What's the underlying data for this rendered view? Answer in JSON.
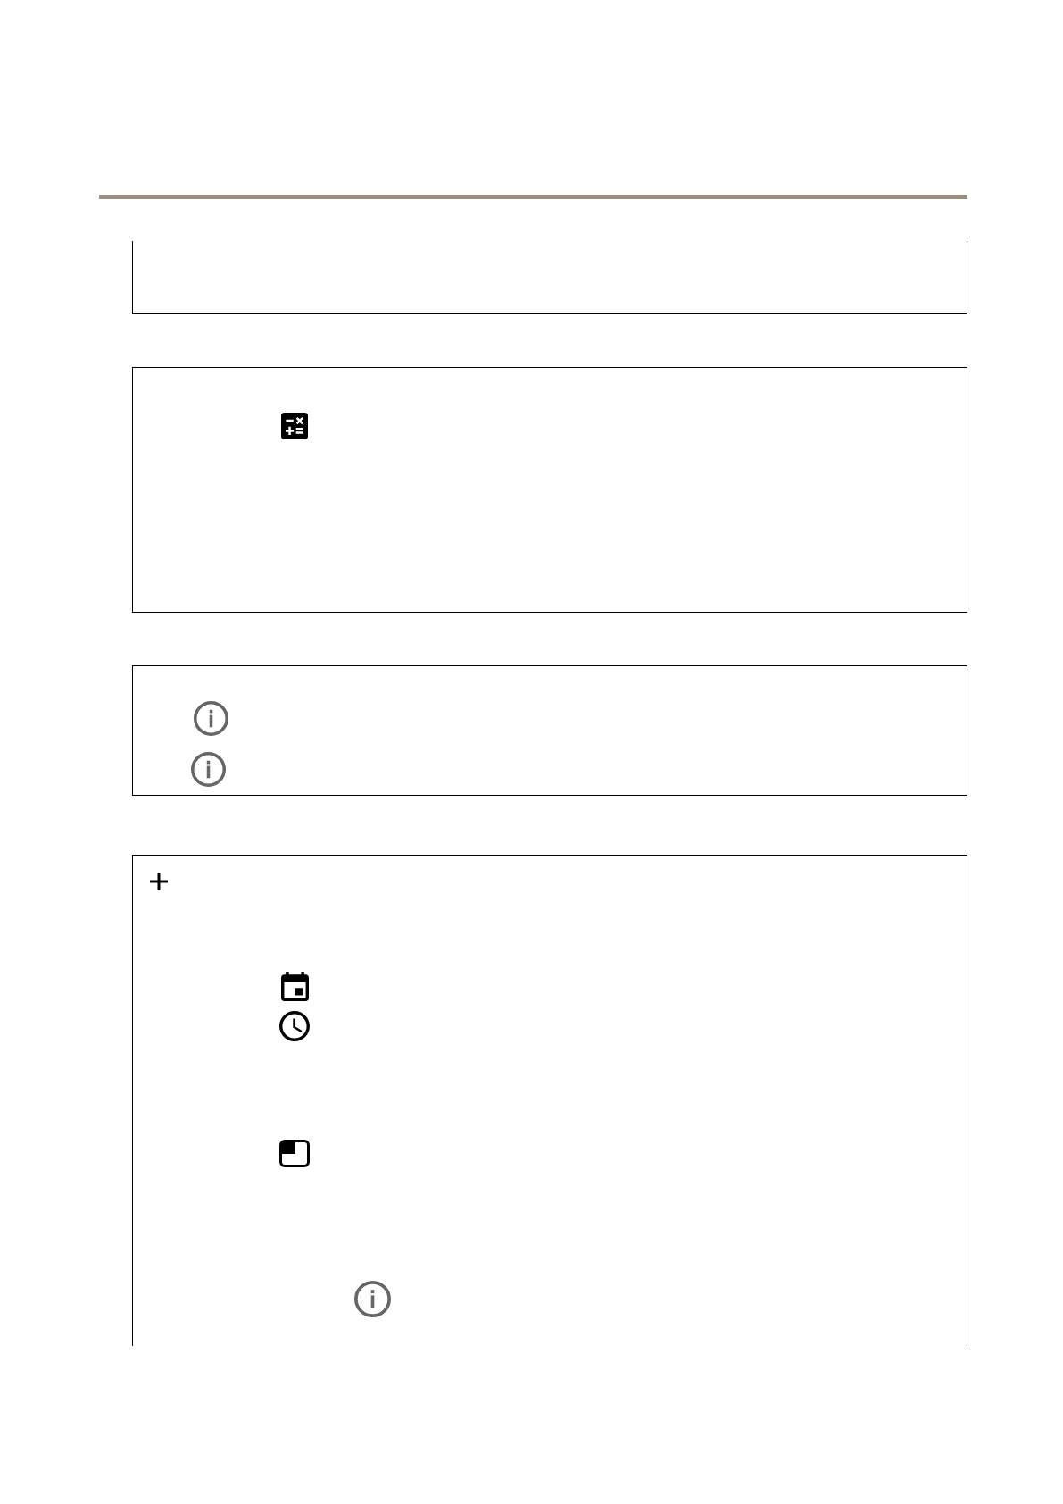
{
  "panels": [
    {
      "open_top": true,
      "open_bottom": false
    },
    {
      "open_top": false,
      "open_bottom": false,
      "icons": [
        {
          "kind": "calculator"
        }
      ]
    },
    {
      "open_top": false,
      "open_bottom": false,
      "icons": [
        {
          "kind": "info"
        },
        {
          "kind": "info"
        }
      ]
    },
    {
      "open_top": false,
      "open_bottom": true,
      "icons": [
        {
          "kind": "plus"
        },
        {
          "kind": "calendar"
        },
        {
          "kind": "clock"
        },
        {
          "kind": "picture-in-picture"
        },
        {
          "kind": "info"
        }
      ]
    }
  ]
}
